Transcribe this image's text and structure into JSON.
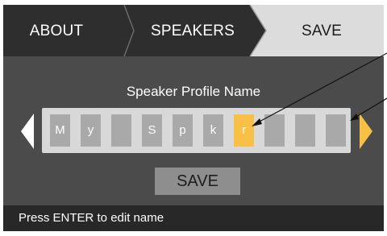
{
  "tabs": [
    {
      "label": "ABOUT",
      "active": false
    },
    {
      "label": "SPEAKERS",
      "active": false
    },
    {
      "label": "SAVE",
      "active": true
    }
  ],
  "profile": {
    "title": "Speaker Profile Name",
    "chars": [
      "M",
      "y",
      "",
      "S",
      "p",
      "k",
      "r",
      "",
      "",
      ""
    ],
    "selected_index": 6
  },
  "save_button": {
    "label": "SAVE"
  },
  "status": {
    "text": "Press ENTER to edit name"
  },
  "colors": {
    "background": "#4b4b4b",
    "tab_active": "#dcdcdc",
    "tab_inactive": "#2e2e2e",
    "highlight": "#f8c145",
    "cell": "#a9a9a9",
    "field": "#d8d8d8",
    "status_bar": "#282828"
  },
  "icons": {
    "left_arrow": "arrow-left-icon",
    "right_arrow": "arrow-right-icon"
  }
}
